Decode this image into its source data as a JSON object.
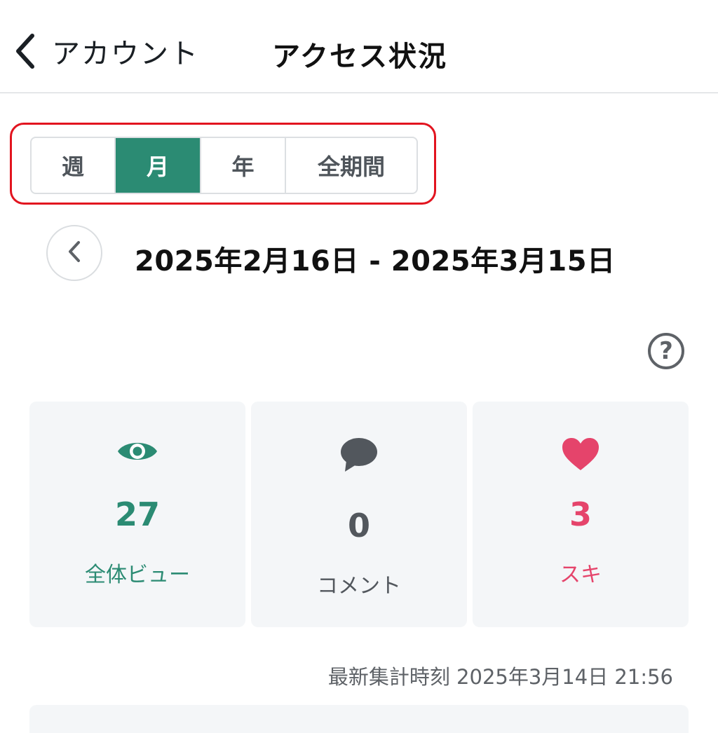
{
  "header": {
    "back_label": "アカウント",
    "title": "アクセス状況"
  },
  "period_tabs": [
    {
      "label": "週",
      "active": false
    },
    {
      "label": "月",
      "active": true
    },
    {
      "label": "年",
      "active": false
    },
    {
      "label": "全期間",
      "active": false
    }
  ],
  "date_range": "2025年2月16日 - 2025年3月15日",
  "help_glyph": "?",
  "stats": {
    "views": {
      "value": "27",
      "label": "全体ビュー",
      "icon": "eye-icon",
      "color": "#2b8b73"
    },
    "comments": {
      "value": "0",
      "label": "コメント",
      "icon": "comment-icon",
      "color": "#52575d"
    },
    "likes": {
      "value": "3",
      "label": "スキ",
      "icon": "heart-icon",
      "color": "#e5446b"
    }
  },
  "updated_at": "最新集計時刻 2025年3月14日 21:56",
  "colors": {
    "accent": "#2b8b73",
    "highlight_border": "#e2141f"
  }
}
